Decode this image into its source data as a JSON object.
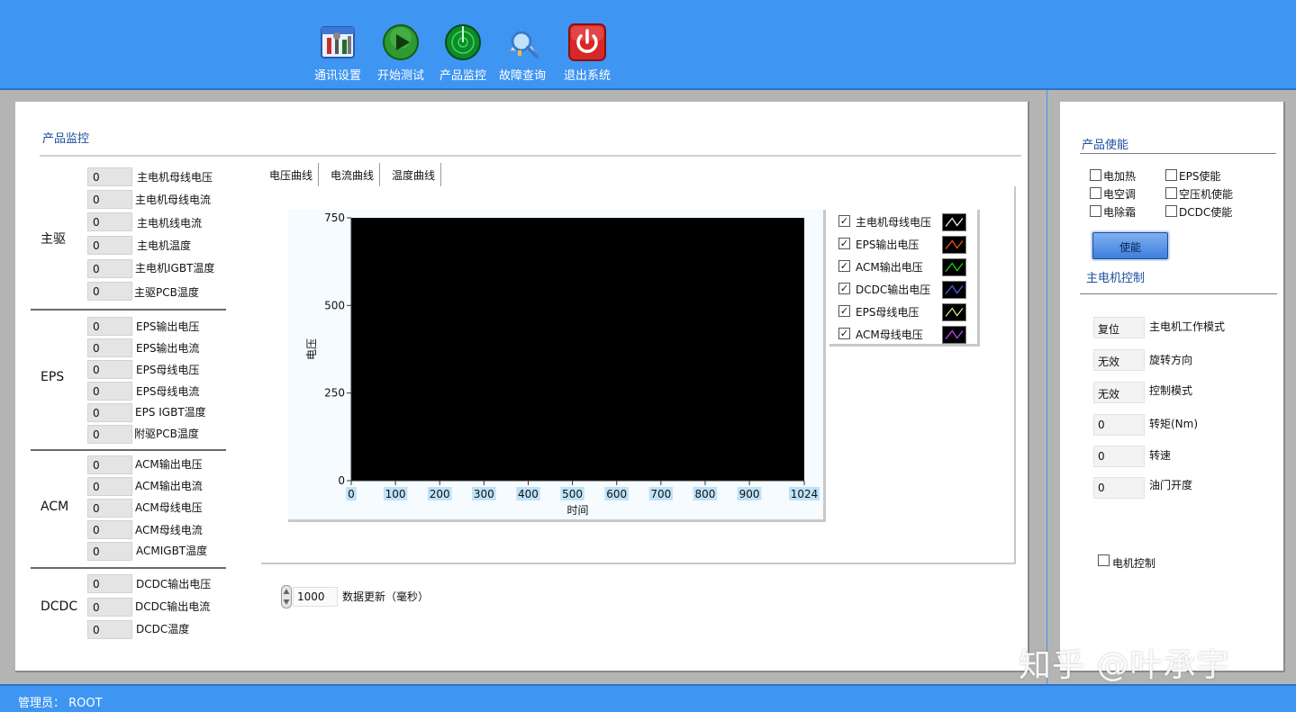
{
  "toolbar": {
    "items": [
      {
        "label": "通讯设置",
        "icon": "settings-tools-icon"
      },
      {
        "label": "开始测试",
        "icon": "play-icon"
      },
      {
        "label": "产品监控",
        "icon": "radar-icon"
      },
      {
        "label": "故障查询",
        "icon": "search-magnifier-icon"
      },
      {
        "label": "退出系统",
        "icon": "power-icon"
      }
    ]
  },
  "main": {
    "title": "产品监控",
    "groups": [
      {
        "name": "主驱",
        "fields": [
          {
            "value": "0",
            "label": "主电机母线电压"
          },
          {
            "value": "0",
            "label": "主电机母线电流"
          },
          {
            "value": "0",
            "label": "主电机线电流"
          },
          {
            "value": "0",
            "label": "主电机温度"
          },
          {
            "value": "0",
            "label": "主电机IGBT温度"
          },
          {
            "value": "0",
            "label": "主驱PCB温度"
          }
        ]
      },
      {
        "name": "EPS",
        "fields": [
          {
            "value": "0",
            "label": "EPS输出电压"
          },
          {
            "value": "0",
            "label": "EPS输出电流"
          },
          {
            "value": "0",
            "label": "EPS母线电压"
          },
          {
            "value": "0",
            "label": "EPS母线电流"
          },
          {
            "value": "0",
            "label": "EPS IGBT温度"
          },
          {
            "value": "0",
            "label": "附驱PCB温度"
          }
        ]
      },
      {
        "name": "ACM",
        "fields": [
          {
            "value": "0",
            "label": "ACM输出电压"
          },
          {
            "value": "0",
            "label": "ACM输出电流"
          },
          {
            "value": "0",
            "label": "ACM母线电压"
          },
          {
            "value": "0",
            "label": "ACM母线电流"
          },
          {
            "value": "0",
            "label": "ACMIGBT温度"
          }
        ]
      },
      {
        "name": "DCDC",
        "fields": [
          {
            "value": "0",
            "label": "DCDC输出电压"
          },
          {
            "value": "0",
            "label": "DCDC输出电流"
          },
          {
            "value": "0",
            "label": "DCDC温度"
          }
        ]
      }
    ],
    "tabs": [
      "电压曲线",
      "电流曲线",
      "温度曲线"
    ],
    "legend": [
      {
        "checked": true,
        "label": "主电机母线电压",
        "color": "#ffffff"
      },
      {
        "checked": true,
        "label": "EPS输出电压",
        "color": "#ff5a1e"
      },
      {
        "checked": true,
        "label": "ACM输出电压",
        "color": "#22dd22"
      },
      {
        "checked": true,
        "label": "DCDC输出电压",
        "color": "#4a6bff"
      },
      {
        "checked": true,
        "label": "EPS母线电压",
        "color": "#f2f28a"
      },
      {
        "checked": true,
        "label": "ACM母线电压",
        "color": "#c44dff"
      }
    ],
    "update_interval": "1000",
    "update_label": "数据更新（毫秒）"
  },
  "chart_data": {
    "type": "line",
    "xlabel": "时间",
    "ylabel": "电压",
    "xlim": [
      0,
      1024
    ],
    "ylim": [
      0,
      750
    ],
    "x_ticks": [
      0,
      100,
      200,
      300,
      400,
      500,
      600,
      700,
      800,
      900,
      1024
    ],
    "y_ticks": [
      0,
      250,
      500,
      750
    ],
    "plot_background": "#000000",
    "grid": false,
    "legend_position": "right",
    "series": [
      {
        "name": "主电机母线电压",
        "values": []
      },
      {
        "name": "EPS输出电压",
        "values": []
      },
      {
        "name": "ACM输出电压",
        "values": []
      },
      {
        "name": "DCDC输出电压",
        "values": []
      },
      {
        "name": "EPS母线电压",
        "values": []
      },
      {
        "name": "ACM母线电压",
        "values": []
      }
    ]
  },
  "right": {
    "enable_title": "产品使能",
    "enable_checks": [
      {
        "label": "电加热",
        "checked": false
      },
      {
        "label": "EPS使能",
        "checked": false
      },
      {
        "label": "电空调",
        "checked": false
      },
      {
        "label": "空压机使能",
        "checked": false
      },
      {
        "label": "电除霜",
        "checked": false
      },
      {
        "label": "DCDC使能",
        "checked": false
      }
    ],
    "enable_button": "使能",
    "motor_title": "主电机控制",
    "motor_fields": [
      {
        "value": "复位",
        "label": "主电机工作模式"
      },
      {
        "value": "无效",
        "label": "旋转方向"
      },
      {
        "value": "无效",
        "label": "控制模式"
      },
      {
        "value": "0",
        "label": "转矩(Nm)"
      },
      {
        "value": "0",
        "label": "转速"
      },
      {
        "value": "0",
        "label": "油门开度"
      }
    ],
    "motor_control_check": {
      "label": "电机控制",
      "checked": false
    }
  },
  "status": {
    "text": "管理员：  ROOT"
  },
  "watermark": "知乎 @叶承宇",
  "colors": {
    "toolbar": "#3f95f2",
    "panel": "#ffffff",
    "accent_title": "#1a4f9c"
  }
}
